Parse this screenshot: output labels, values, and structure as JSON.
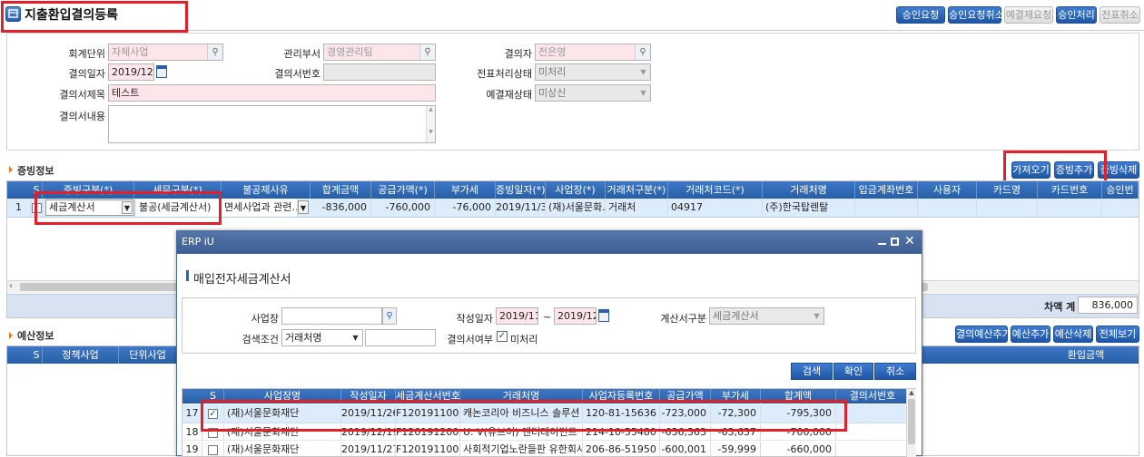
{
  "title": "지출환입결의등록",
  "toolbar": {
    "req_approval": "승인요청",
    "cancel_req_approval": "승인요청취소",
    "cancel_approve_req": "예결재요청",
    "approve": "승인처리",
    "slip_cancel": "전표취소"
  },
  "form": {
    "unit_label": "회계단위",
    "unit_value": "자체사업",
    "dept_label": "관리부서",
    "dept_value": "경영관리팀",
    "approver_label": "결의자",
    "approver_value": "전은영",
    "date_label": "결의일자",
    "date_value": "2019/12/24",
    "no_label": "결의서번호",
    "no_value": "",
    "slip_status_label": "전표처리상태",
    "slip_status_value": "미처리",
    "title_label": "결의서제목",
    "title_value": "테스트",
    "pre_status_label": "예결재상태",
    "pre_status_value": "미상신",
    "content_label": "결의서내용"
  },
  "evidence": {
    "header": "증빙정보",
    "btn_fetch": "가져오기",
    "btn_add": "증빙추가",
    "btn_delete": "증빙삭제",
    "columns": [
      "S",
      "증빙구분(*)",
      "세무구분(*)",
      "불공제사유",
      "합계금액",
      "공급가액(*)",
      "부가세",
      "증빙일자(*)",
      "사업장(*)",
      "거래처구분(*)",
      "거래처코드(*)",
      "거래처명",
      "입금계좌번호",
      "사용자",
      "카드명",
      "카드번호",
      "승인번"
    ],
    "row": {
      "no": "1",
      "evid_type": "세금계산서",
      "tax_type": "불공(세금계산서)",
      "reason": "면세사업과 관련…",
      "total": "-836,000",
      "supply": "-760,000",
      "vat": "-76,000",
      "date": "2019/11/30",
      "biz": "(재)서울문화…",
      "vendor_type": "거래처",
      "vendor_code": "04917",
      "vendor_name": "(주)한국탑렌탈"
    },
    "diff_label": "차액 계",
    "diff_value": "836,000"
  },
  "budget": {
    "header": "예산정보",
    "columns": [
      "S",
      "정책사업",
      "단위사업"
    ],
    "btn_add": "결의예산추가",
    "btn_add2": "예산추가",
    "btn_delete": "예산삭제",
    "btn_view": "전체보기",
    "col_right": "환입금액"
  },
  "modal": {
    "window_title": "ERP iU",
    "title": "매입전자세금계산서",
    "biz_label": "사업장",
    "biz_value": "",
    "date_label": "작성일자",
    "date_from": "2019/11/24",
    "date_tilde": "~",
    "date_to": "2019/12/24",
    "invoice_type_label": "계산서구분",
    "invoice_type_value": "세금계산서",
    "search_cond_label": "검색조건",
    "search_cond_value": "거래처명",
    "search_text": "",
    "approved_label": "결의서여부",
    "approved_value": "미처리",
    "btn_search": "검색",
    "btn_ok": "확인",
    "btn_cancel": "취소",
    "columns": [
      "S",
      "사업장명",
      "작성일자",
      "세금계산서번호",
      "거래처명",
      "사업자등록번호",
      "공급가액",
      "부가세",
      "합계액",
      "결의서번호"
    ],
    "rows": [
      {
        "no": "17",
        "checked": true,
        "biz": "(재)서울문화재단",
        "date": "2019/11/26",
        "inv": "F120191100182",
        "vendor": "캐논코리아 비즈니스 솔루션",
        "reg": "120-81-15636",
        "supply": "-723,000",
        "vat": "-72,300",
        "total": "-795,300"
      },
      {
        "no": "18",
        "checked": false,
        "biz": "(재)서울문화재단",
        "date": "2019/12/19",
        "inv": "F120191200246",
        "vendor": "U. V(유브이) 엔터테이먼트",
        "reg": "214-10-55480",
        "supply": "-636,363",
        "vat": "-63,637",
        "total": "-700,000"
      },
      {
        "no": "19",
        "checked": false,
        "biz": "(재)서울문화재단",
        "date": "2019/11/27",
        "inv": "F120191100280",
        "vendor": "사회적기업노란들판 유한회사",
        "reg": "206-86-51950",
        "supply": "-600,001",
        "vat": "-59,999",
        "total": "-660,000"
      }
    ]
  },
  "colors": {
    "accent": "#2a63b0",
    "required": "#fde6ea",
    "highlight": "#e0202a",
    "selected_row": "#dcecfb"
  }
}
